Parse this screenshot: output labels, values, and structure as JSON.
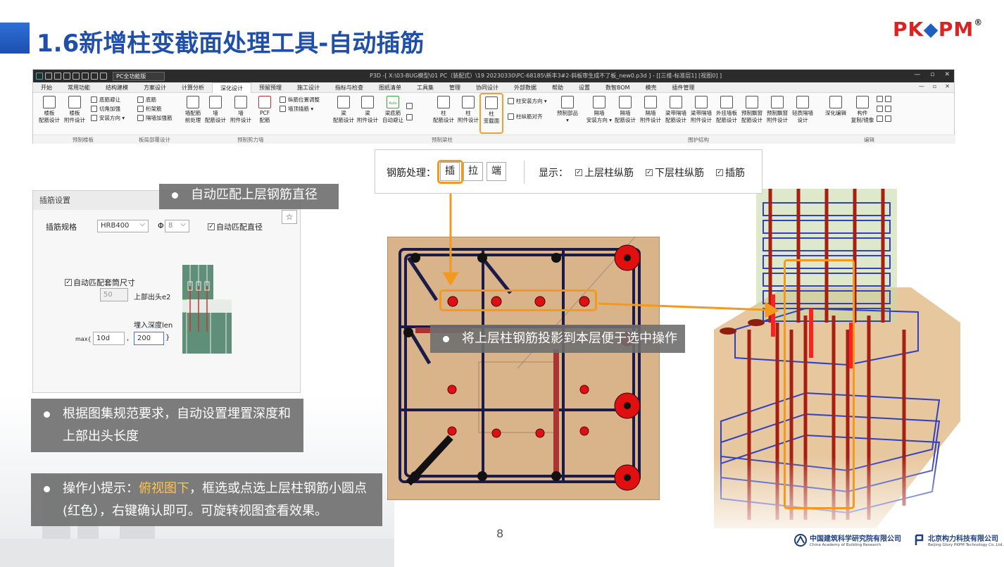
{
  "slide": {
    "title": "1.6新增柱变截面处理工具-自动插筋",
    "page_number": "8"
  },
  "logo": {
    "text_pk": "PK",
    "text_d": "⬥",
    "text_pm": "PM",
    "reg": "®"
  },
  "app": {
    "mode_select": "PC全功能版",
    "window_title": "P3D -[ X:\\03-BUG模型\\01 PC（装配式）\\19 20230330\\PC-68185\\新丰3#2-斜板审生成不了板_new0.p3d ] - [[三维-标准层1] [视图0] ]",
    "window_controls": [
      "—",
      "▫",
      "✕"
    ],
    "doc_controls": [
      "—",
      "▫",
      "✕"
    ],
    "menu": [
      "开始",
      "常用功能",
      "结构建模",
      "方案设计",
      "计算分析",
      "深化设计",
      "预留预埋",
      "施工设计",
      "指标与检查",
      "图纸清单",
      "工具集",
      "管理",
      "协同设计",
      "外部数据",
      "帮助",
      "设置",
      "数智BOM",
      "模壳",
      "插件管理"
    ],
    "active_menu": "深化设计",
    "ribbon": {
      "b1": "楼板\n配筋设计",
      "b2": "楼板\n附件设计",
      "s1": "底筋避让",
      "s2": "切角加强",
      "s3": "安装方向 ▾",
      "s4": "底筋",
      "s5": "桁架筋",
      "s6": "隔墙加强筋",
      "b3": "墙配筋\n前处理",
      "b4": "墙\n配筋设计",
      "b5": "墙\n附件设计",
      "b6": "PCF\n配筋",
      "s7": "纵筋位置调整",
      "s8": "墙顶插筋 ▾",
      "b7": "梁\n配筋设计",
      "b8": "梁\n附件设计",
      "b9": "梁底筋\n自动避让",
      "auto_label": "Auto",
      "b10": "柱\n配筋设计",
      "b11": "柱\n附件设计",
      "b12": "柱\n变截面",
      "s9": "柱安装方向 ▾",
      "s10": "柱纵筋对齐",
      "b13": "预制部品\n▾",
      "b14": "隔墙\n安装方向 ▾",
      "b15": "隔墙\n配筋设计",
      "b16": "隔墙\n附件设计",
      "b17": "梁带隔墙\n配筋设计",
      "b18": "梁带隔墙\n附件设计",
      "b19": "外挂墙板\n配筋设计",
      "b20": "预制飘窗\n配筋设计",
      "b21": "预制飘窗\n附件设计",
      "b22": "轻质隔墙\n设计",
      "b23": "深化编辑",
      "b24": "构件\n复制/镜像"
    },
    "groups": [
      "预制楼板",
      "板局部覆设计",
      "预制剪力墙",
      "预制梁柱",
      "围护结构",
      "编辑"
    ]
  },
  "panel": {
    "title": "插筋设置",
    "spec_label": "插筋规格",
    "spec_value": "HRB400",
    "phi": "Φ",
    "dia_value": "8",
    "auto_dia": "自动匹配直径",
    "auto_sleeve": "自动匹配套筒尺寸",
    "e2_value": "50",
    "e2_label": "上部出头e2",
    "len_label": "埋入深度len",
    "max_label": "max{",
    "max_v1": "10d",
    "comma": ",",
    "max_v2": "200",
    "close_brace": "}",
    "pin_icon": "☆"
  },
  "callouts": {
    "c1": "自动匹配上层钢筋直径",
    "c2": "将上层柱钢筋投影到本层便于选中操作",
    "c3a": "根据图集规范要求，自动设置埋置深度和",
    "c3b": "上部出头长度",
    "c4_pre": "操作小提示：",
    "c4_hl": "俯视图下",
    "c4_post": "，框选或点选上层柱钢筋小圆点",
    "c4_line2": "(红色），右键确认即可。可旋转视图查看效果。"
  },
  "tool": {
    "proc_label": "钢筋处理：",
    "btn_insert": "插",
    "btn_pull": "拉",
    "btn_end": "端",
    "show_label": "显示：",
    "chk_upper": "上层柱纵筋",
    "chk_lower": "下层柱纵筋",
    "chk_insert": "插筋"
  },
  "footer": {
    "org1_cn": "中国建筑科学研究院有限公司",
    "org1_en": "China Academy of Building Research",
    "org2_cn": "北京构力科技有限公司",
    "org2_en": "Beijing Glory PKPM Technology Co.,Ltd."
  },
  "colors": {
    "title": "#1f4fa8",
    "accent_orange": "#f39a1e",
    "rebar_red": "#e01010",
    "rebar_blue": "#3040c0",
    "concrete": "#d9b48a"
  }
}
